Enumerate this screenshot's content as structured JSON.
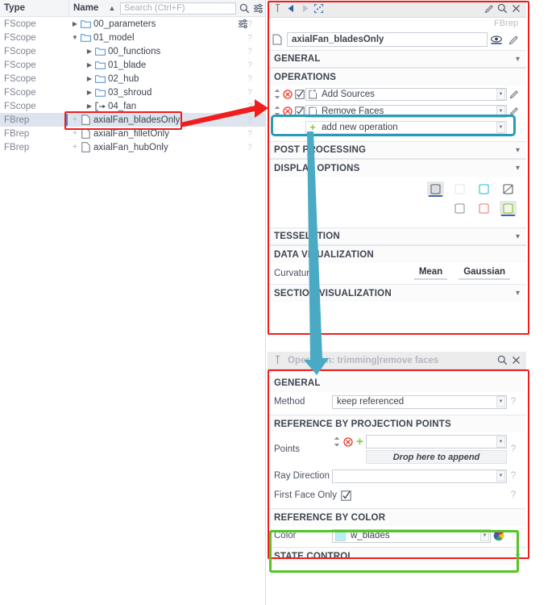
{
  "tree": {
    "columns": {
      "type": "Type",
      "name": "Name"
    },
    "search": {
      "placeholder": "Search (Ctrl+F)"
    },
    "icons": {
      "sort": "sort-caret-up-icon",
      "search": "search-icon",
      "filter": "filter-sliders-icon",
      "filter2": "filter-sliders-icon"
    },
    "rows": [
      {
        "type": "FScope",
        "label": "00_parameters",
        "depth": 0,
        "icon": "folder-icon",
        "expander": "collapsed",
        "selected": false
      },
      {
        "type": "FScope",
        "label": "01_model",
        "depth": 0,
        "icon": "folder-icon",
        "expander": "expanded",
        "selected": false
      },
      {
        "type": "FScope",
        "label": "00_functions",
        "depth": 1,
        "icon": "folder-icon",
        "expander": "collapsed",
        "selected": false
      },
      {
        "type": "FScope",
        "label": "01_blade",
        "depth": 1,
        "icon": "folder-icon",
        "expander": "collapsed",
        "selected": false
      },
      {
        "type": "FScope",
        "label": "02_hub",
        "depth": 1,
        "icon": "folder-icon",
        "expander": "collapsed",
        "selected": false
      },
      {
        "type": "FScope",
        "label": "03_shroud",
        "depth": 1,
        "icon": "folder-icon",
        "expander": "collapsed",
        "selected": false
      },
      {
        "type": "FScope",
        "label": "04_fan",
        "depth": 1,
        "icon": "scope-arrow-icon",
        "expander": "collapsed",
        "selected": false
      },
      {
        "type": "FBrep",
        "label": "axialFan_bladesOnly",
        "depth": 0,
        "icon": "document-icon",
        "expander": "plus",
        "selected": true
      },
      {
        "type": "FBrep",
        "label": "axialFan_filletOnly",
        "depth": 0,
        "icon": "document-icon",
        "expander": "plus",
        "selected": false
      },
      {
        "type": "FBrep",
        "label": "axialFan_hubOnly",
        "depth": 0,
        "icon": "document-icon",
        "expander": "plus",
        "selected": false
      }
    ]
  },
  "brep_panel": {
    "titlebar_icons": [
      "pin-icon",
      "back-arrow-icon",
      "forward-arrow-icon",
      "fit-selection-icon",
      "edit-pencil-icon",
      "search-icon",
      "close-icon"
    ],
    "type_tag": "FBrep",
    "name_value": "axialFan_bladesOnly",
    "name_icon": "document-icon",
    "visibility_icon": "eye-icon",
    "edit_icon": "edit-pencil-icon",
    "sections": {
      "general": "GENERAL",
      "operations": "OPERATIONS",
      "post_processing": "POST PROCESSING",
      "display_options": "DISPLAY OPTIONS",
      "tesselation": "TESSELATION",
      "data_visualization": "DATA VISUALIZATION",
      "section_visualization": "SECTION VISUALIZATION"
    },
    "operations": [
      {
        "label": "Add Sources",
        "icon": "add-source-icon",
        "checked": true,
        "delete_icon": "delete-circle-icon",
        "highlighted": false
      },
      {
        "label": "Remove Faces",
        "icon": "remove-faces-icon",
        "checked": true,
        "delete_icon": "delete-circle-icon",
        "highlighted": true
      }
    ],
    "add_operation_label": "add new operation",
    "add_operation_icon": "plus-icon",
    "display_options": {
      "row1": [
        {
          "name": "shaded-face-icon",
          "stroke": "#6a7078",
          "fill": "#dcdee1",
          "active": true
        },
        {
          "name": "hidden-face-icon",
          "stroke": "#e7e9ec",
          "fill": "#ffffff",
          "active": false
        },
        {
          "name": "cyan-outline-face-icon",
          "stroke": "#39c9dd",
          "fill": "#ffffff",
          "active": false
        },
        {
          "name": "diagonal-face-icon",
          "stroke": "#6a7078",
          "fill": "#ffffff",
          "active": false
        }
      ],
      "row2": [
        {
          "name": "grey-outline-face-icon",
          "stroke": "#9aa0a8",
          "fill": "#ffffff",
          "active": false
        },
        {
          "name": "red-outline-face-icon",
          "stroke": "#f08a7e",
          "fill": "#ffffff",
          "active": false
        },
        {
          "name": "green-outline-face-icon",
          "stroke": "#8dc63f",
          "fill": "#f3f7ea",
          "active": true
        }
      ]
    },
    "curvature": {
      "label": "Curvature",
      "mean": "Mean",
      "gaussian": "Gaussian"
    }
  },
  "operation_panel": {
    "title": "Operation: trimming|remove faces",
    "titlebar_icons": [
      "pin-icon",
      "search-icon",
      "close-icon"
    ],
    "sections": {
      "general": "GENERAL",
      "reference_by_projection_points": "REFERENCE BY PROJECTION POINTS",
      "reference_by_color": "REFERENCE BY COLOR",
      "state_control": "STATE CONTROL"
    },
    "method": {
      "label": "Method",
      "value": "keep referenced"
    },
    "points": {
      "label": "Points",
      "value": "",
      "drop_hint": "Drop here to append",
      "spin_icon": "spinner-updown-icon",
      "clear_icon": "delete-circle-icon",
      "add_icon": "plus-icon"
    },
    "ray_direction": {
      "label": "Ray Direction",
      "value": ""
    },
    "first_face_only": {
      "label": "First Face Only",
      "checked": true
    },
    "color": {
      "label": "Color",
      "value": "w_blades",
      "swatch": "#b7f0f2",
      "picker_icon": "color-wheel-icon"
    },
    "help_marker": "?"
  },
  "annotations": {
    "red_arrow": {
      "name": "red-arrow-tree-to-panel",
      "color": "#f11d1d"
    },
    "teal_arrow": {
      "name": "teal-arrow-operation-to-panel",
      "color": "#4aaac4"
    },
    "red_box_tree": {
      "name": "red-highlight-tree-item",
      "color": "#f11d1d"
    },
    "red_box_brep": {
      "name": "red-highlight-brep-panel",
      "color": "#f11d1d"
    },
    "teal_box_op": {
      "name": "teal-highlight-remove-faces-row",
      "color": "#2a9ab5"
    },
    "red_box_operation": {
      "name": "red-highlight-operation-panel",
      "color": "#f11d1d"
    },
    "green_box_color": {
      "name": "green-highlight-reference-by-color",
      "color": "#54c428"
    }
  }
}
